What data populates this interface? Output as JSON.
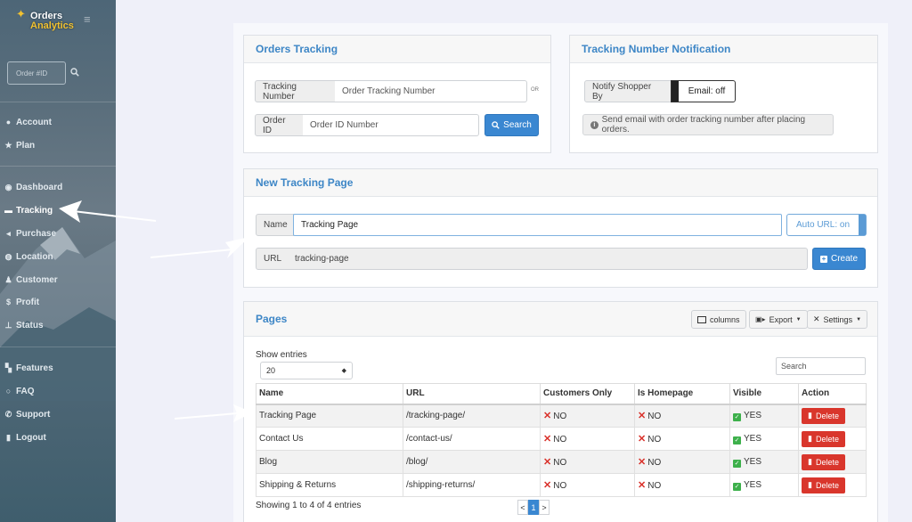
{
  "sidebar": {
    "logo_line1": "Orders",
    "logo_line2": "Analytics",
    "order_placeholder": "Order #ID",
    "items": [
      {
        "label": "Account",
        "icon": "account-icon"
      },
      {
        "label": "Plan",
        "icon": "star-icon"
      },
      {
        "label": "Dashboard",
        "icon": "dashboard-icon"
      },
      {
        "label": "Tracking",
        "icon": "truck-icon"
      },
      {
        "label": "Purchase",
        "icon": "megaphone-icon"
      },
      {
        "label": "Location",
        "icon": "globe-icon"
      },
      {
        "label": "Customer",
        "icon": "user-icon"
      },
      {
        "label": "Profit",
        "icon": "dollar-icon"
      },
      {
        "label": "Status",
        "icon": "sitemap-icon"
      },
      {
        "label": "Features",
        "icon": "cubes-icon"
      },
      {
        "label": "FAQ",
        "icon": "search-icon"
      },
      {
        "label": "Support",
        "icon": "phone-icon"
      },
      {
        "label": "Logout",
        "icon": "logout-icon"
      }
    ],
    "active": "Tracking"
  },
  "orders_tracking": {
    "title": "Orders Tracking",
    "tracking_label": "Tracking Number",
    "tracking_placeholder": "Order Tracking Number",
    "or_label": "OR",
    "order_label": "Order ID",
    "order_placeholder": "Order ID Number",
    "search_label": "Search"
  },
  "notification": {
    "title": "Tracking Number Notification",
    "notify_label": "Notify Shopper By",
    "toggle_label": "Email: off",
    "info_text": "Send email with order tracking number after placing orders."
  },
  "new_page": {
    "title": "New Tracking Page",
    "name_label": "Name",
    "name_value": "Tracking Page",
    "auto_url_label": "Auto URL: on",
    "url_label": "URL",
    "url_value": "tracking-page",
    "create_label": "Create"
  },
  "pages": {
    "title": "Pages",
    "columns_label": "columns",
    "export_label": "Export",
    "settings_label": "Settings",
    "show_entries_label": "Show entries",
    "entries_value": "20",
    "search_placeholder": "Search",
    "headers": [
      "Name",
      "URL",
      "Customers Only",
      "Is Homepage",
      "Visible",
      "Action"
    ],
    "rows": [
      {
        "name": "Tracking Page",
        "url": "/tracking-page/",
        "customers_only": "NO",
        "is_homepage": "NO",
        "visible": "YES",
        "action": "Delete"
      },
      {
        "name": "Contact Us",
        "url": "/contact-us/",
        "customers_only": "NO",
        "is_homepage": "NO",
        "visible": "YES",
        "action": "Delete"
      },
      {
        "name": "Blog",
        "url": "/blog/",
        "customers_only": "NO",
        "is_homepage": "NO",
        "visible": "YES",
        "action": "Delete"
      },
      {
        "name": "Shipping & Returns",
        "url": "/shipping-returns/",
        "customers_only": "NO",
        "is_homepage": "NO",
        "visible": "YES",
        "action": "Delete"
      }
    ],
    "footer_text": "Showing 1 to 4 of 4 entries",
    "pager": {
      "prev": "<",
      "current": "1",
      "next": ">"
    }
  },
  "colors": {
    "accent": "#3a87d1",
    "danger": "#d9362c",
    "success": "#3db04b"
  }
}
